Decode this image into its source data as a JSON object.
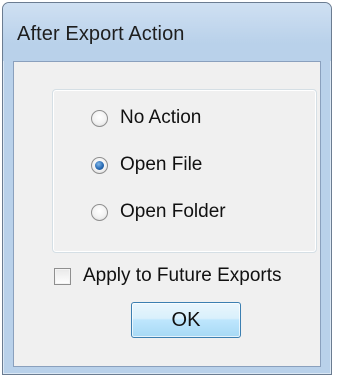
{
  "window": {
    "title": "After Export Action"
  },
  "action_options": {
    "items": [
      {
        "label": "No Action",
        "selected": false
      },
      {
        "label": "Open File",
        "selected": true
      },
      {
        "label": "Open Folder",
        "selected": false
      }
    ]
  },
  "apply_future": {
    "label": "Apply to Future Exports",
    "checked": false
  },
  "buttons": {
    "ok_label": "OK"
  },
  "colors": {
    "frame": "#b9d1ea",
    "client_background": "#f0f0f0",
    "button_border": "#3c7fb1",
    "radio_selected_dot": "#2a6cb5"
  }
}
